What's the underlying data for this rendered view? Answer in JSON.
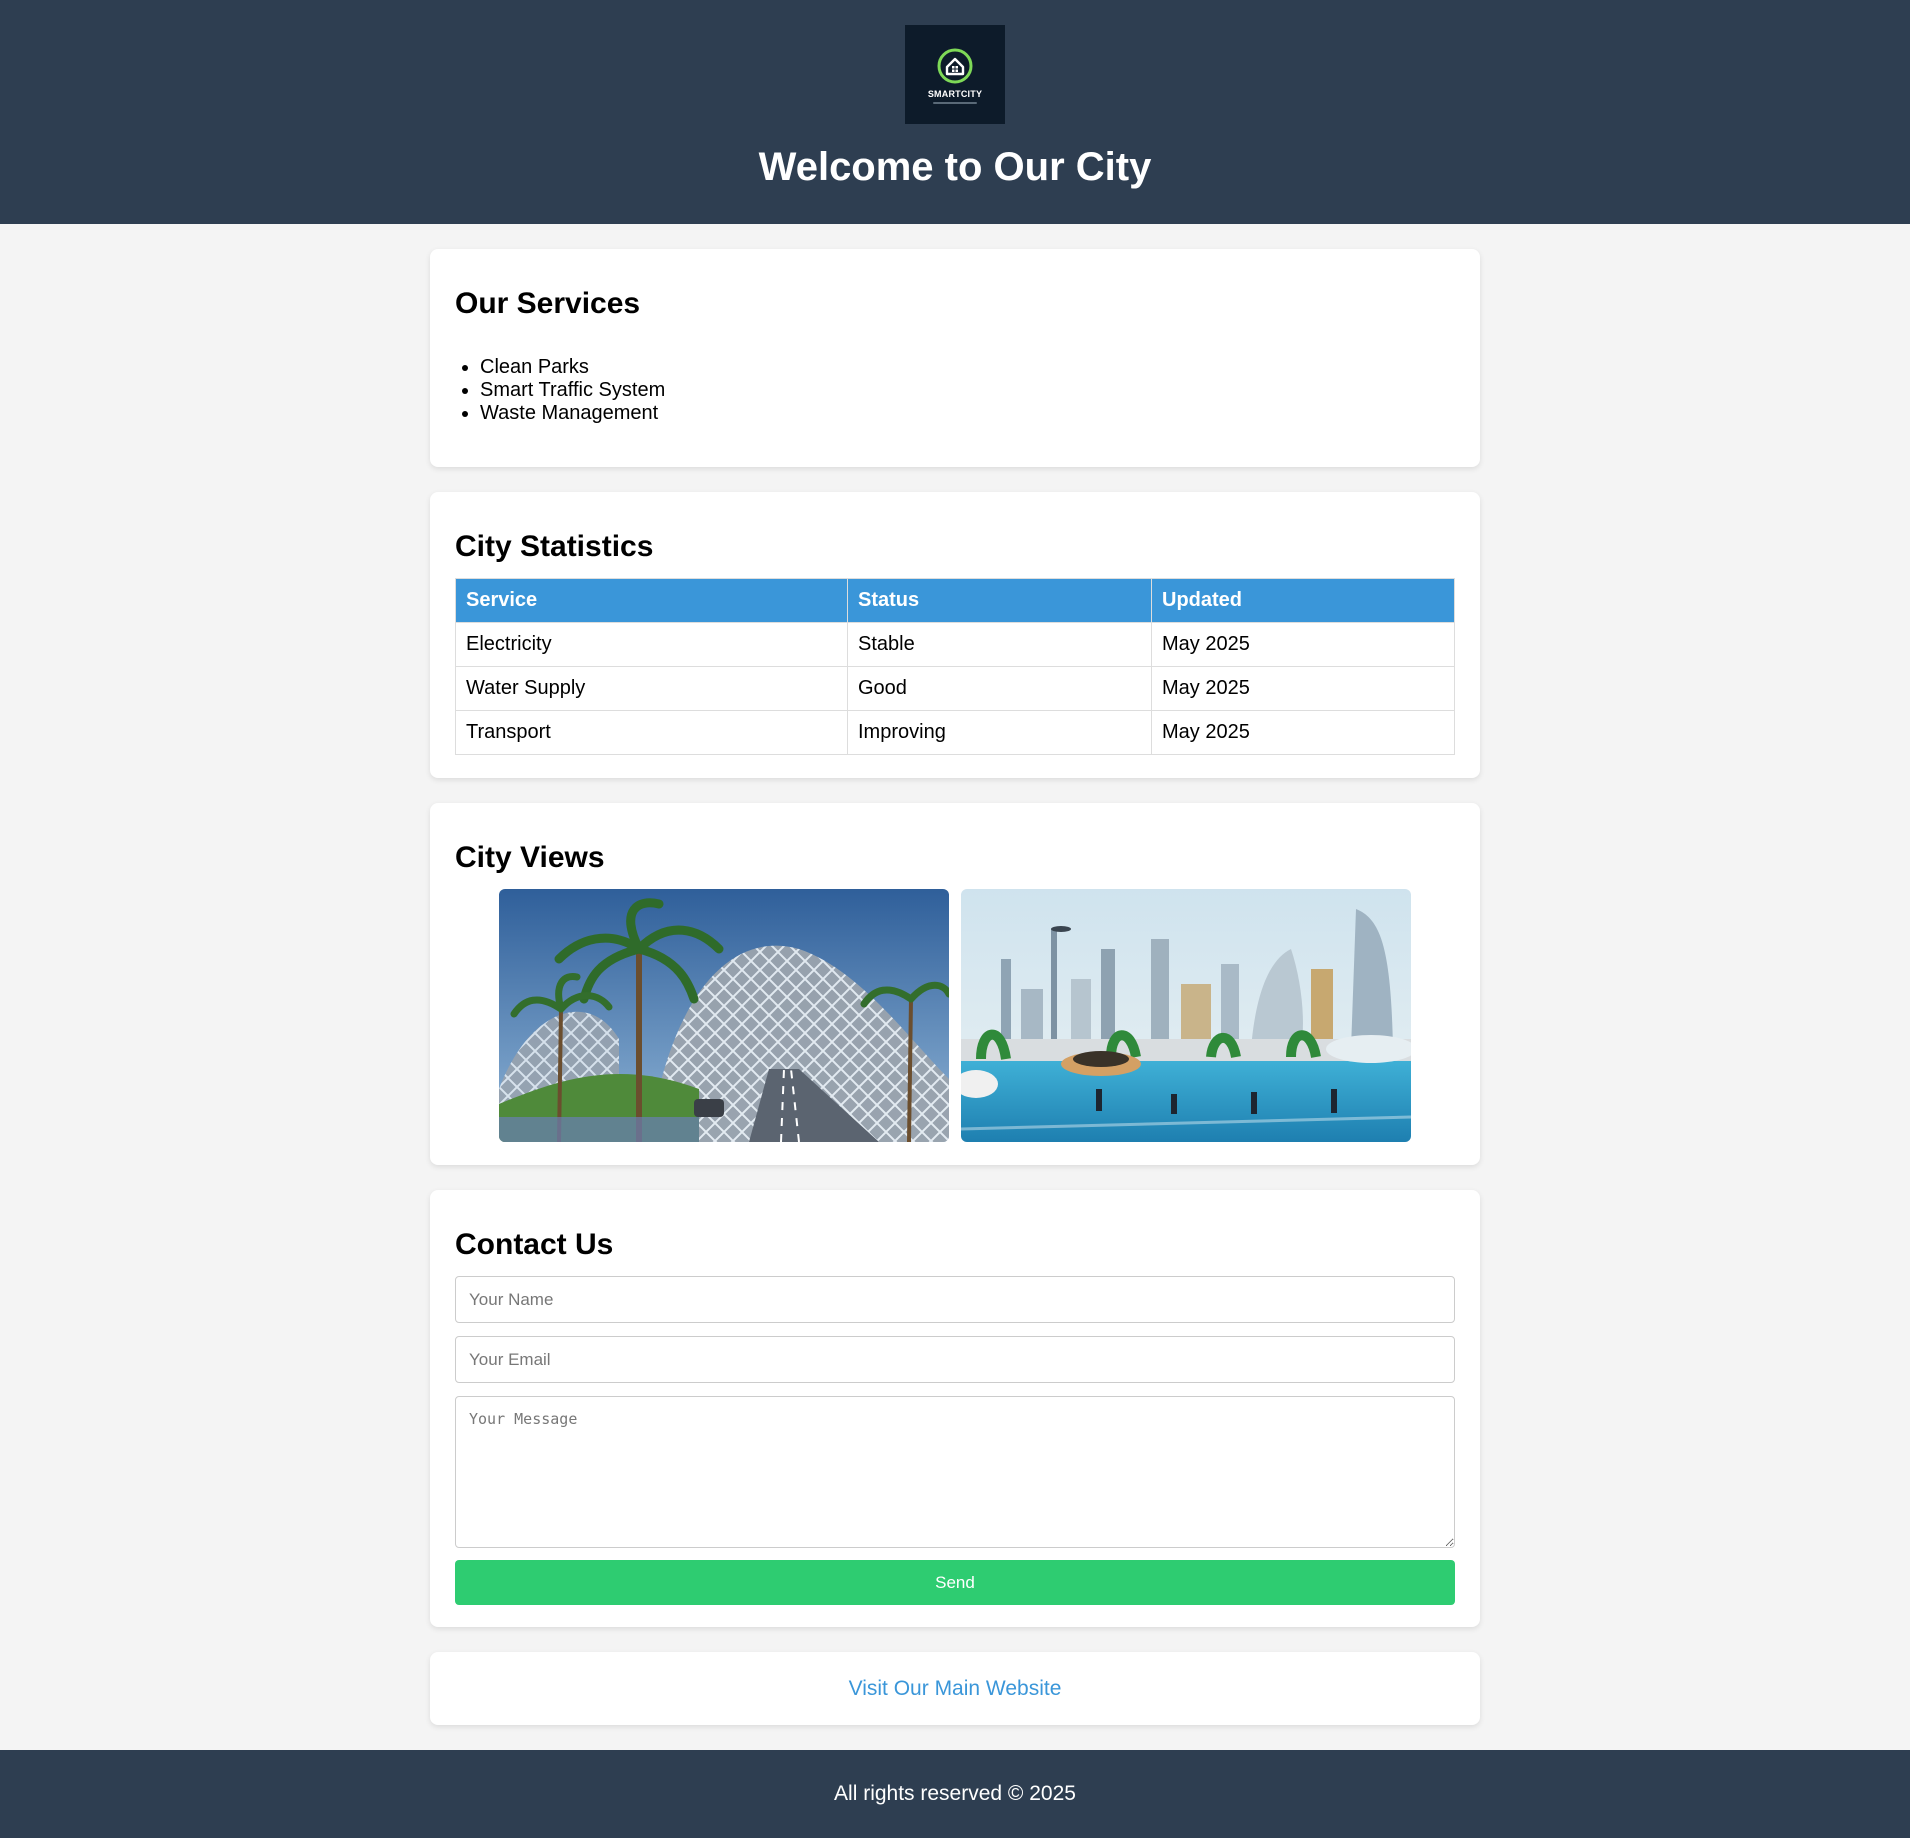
{
  "header": {
    "logo_text": "SMARTCITY",
    "title": "Welcome to Our City"
  },
  "services": {
    "heading": "Our Services",
    "items": [
      "Clean Parks",
      "Smart Traffic System",
      "Waste Management"
    ]
  },
  "stats": {
    "heading": "City Statistics",
    "columns": [
      "Service",
      "Status",
      "Updated"
    ],
    "rows": [
      [
        "Electricity",
        "Stable",
        "May 2025"
      ],
      [
        "Water Supply",
        "Good",
        "May 2025"
      ],
      [
        "Transport",
        "Improving",
        "May 2025"
      ]
    ]
  },
  "views": {
    "heading": "City Views"
  },
  "contact": {
    "heading": "Contact Us",
    "name_placeholder": "Your Name",
    "email_placeholder": "Your Email",
    "message_placeholder": "Your Message",
    "send_label": "Send"
  },
  "link": {
    "label": "Visit Our Main Website"
  },
  "footer": {
    "text": "All rights reserved © 2025"
  },
  "colors": {
    "header_bg": "#2e3e51",
    "table_header": "#3a96d9",
    "send_button": "#2ecc71",
    "link": "#3a96d9",
    "logo_bg": "#0d1b2a",
    "logo_accent": "#7ed957"
  }
}
